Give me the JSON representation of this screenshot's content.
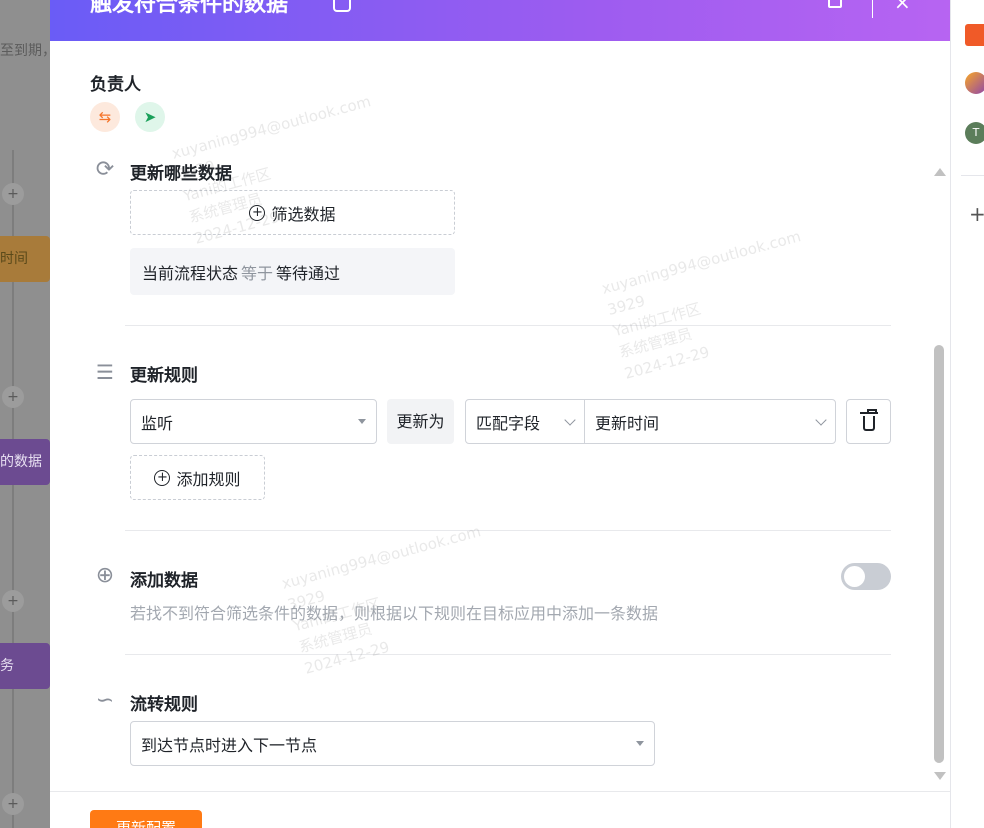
{
  "background": {
    "left_text_top": "至到期，",
    "node_1": "时间",
    "node_2": "的数据",
    "node_3": "务",
    "plus": "+"
  },
  "right_strip": {
    "avatar_letter": "T",
    "add": "+"
  },
  "drawer": {
    "title": "触发符合条件的数据",
    "close": "×"
  },
  "owner": {
    "label": "负责人"
  },
  "update_data": {
    "title": "更新哪些数据",
    "filter_button": "筛选数据",
    "condition_field": "当前流程状态",
    "condition_op": "等于",
    "condition_value": "等待通过"
  },
  "update_rules": {
    "title": "更新规则",
    "field_select": "监听",
    "update_to_label": "更新为",
    "mode_select": "匹配字段",
    "target_select": "更新时间",
    "add_rule_button": "添加规则"
  },
  "add_data": {
    "title": "添加数据",
    "description": "若找不到符合筛选条件的数据，则根据以下规则在目标应用中添加一条数据",
    "toggle_on": false
  },
  "flow_rules": {
    "title": "流转规则",
    "select_value": "到达节点时进入下一节点"
  },
  "footer": {
    "primary_button": "更新配置"
  },
  "watermark": {
    "email": "xuyaning994@outlook.com",
    "id": "3929",
    "workspace": "Yani的工作区",
    "role": "系统管理员",
    "date": "2024-12-29"
  },
  "colors": {
    "header_start": "#6a5cf6",
    "header_end": "#b764f2",
    "primary": "#ff7a14"
  }
}
